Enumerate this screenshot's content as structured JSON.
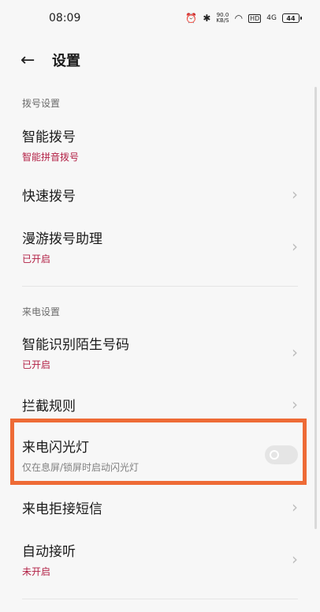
{
  "status": {
    "time": "08:09",
    "alarm": "⏰",
    "bluetooth": "✱",
    "speed_top": "90.0",
    "speed_bottom": "KB/S",
    "wifi": "◠",
    "hd": "HD",
    "signal": "4G",
    "battery": "44"
  },
  "header": {
    "back": "←",
    "title": "设置"
  },
  "sections": {
    "dial": "拨号设置",
    "incoming": "来电设置"
  },
  "items": [
    {
      "title": "智能拨号",
      "subtitle": "智能拼音拨号"
    },
    {
      "title": "快速拨号"
    },
    {
      "title": "漫游拨号助理",
      "subtitle": "已开启"
    },
    {
      "title": "智能识别陌生号码",
      "subtitle": "已开启"
    },
    {
      "title": "拦截规则"
    },
    {
      "title": "来电闪光灯",
      "subtitle": "仅在息屏/锁屏时启动闪光灯",
      "toggle_on": false
    },
    {
      "title": "来电拒接短信"
    },
    {
      "title": "自动接听",
      "subtitle": "未开启"
    }
  ],
  "chevron": "›",
  "colors": {
    "subtitle": "#b21f44",
    "highlight": "#ee6b36"
  }
}
